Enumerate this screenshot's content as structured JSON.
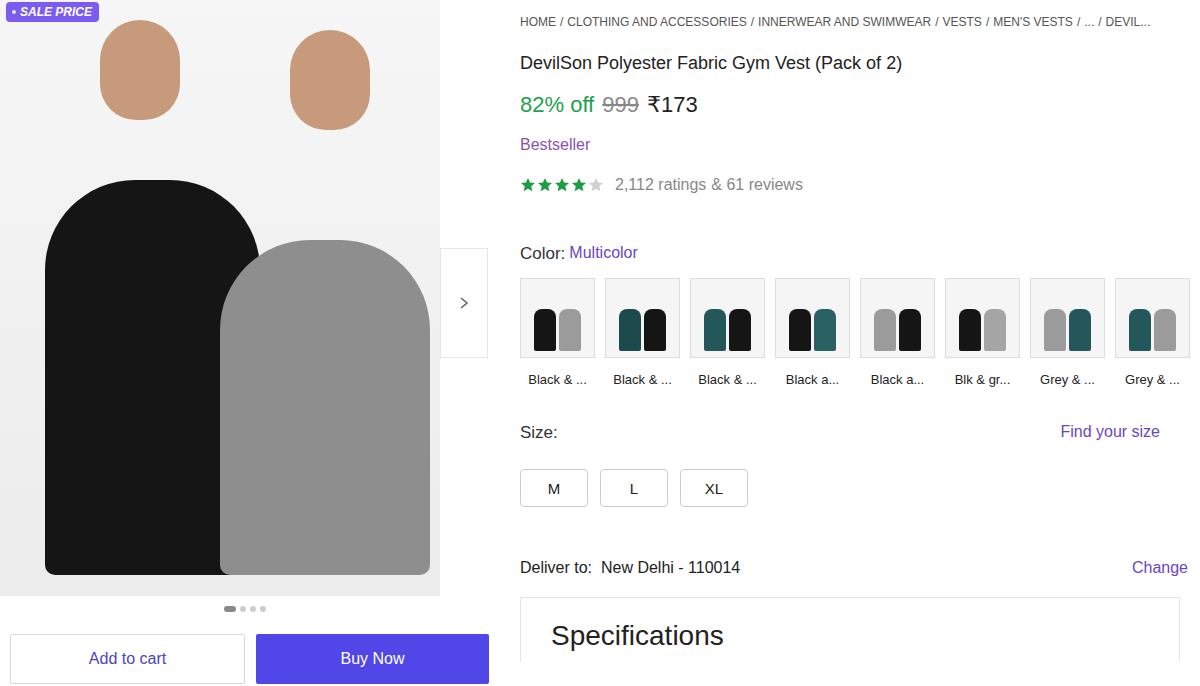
{
  "badge": "SALE PRICE",
  "breadcrumb": {
    "separator": "/",
    "items": [
      "HOME",
      "CLOTHING AND ACCESSORIES",
      "INNERWEAR AND SWIMWEAR",
      "VESTS",
      "MEN'S VESTS",
      "...",
      "DEVIL..."
    ]
  },
  "product": {
    "title": "DevilSon Polyester Fabric Gym Vest (Pack of 2)",
    "discount": "82% off",
    "mrp": "999",
    "price": "₹173",
    "tag": "Bestseller"
  },
  "rating": {
    "stars": 4,
    "ratings": "2,112 ratings",
    "reviews": "& 61 reviews"
  },
  "color": {
    "label": "Color:",
    "value": "Multicolor",
    "options": [
      {
        "label": "Black & ...",
        "colors": [
          "#151515",
          "#9b9b9b"
        ]
      },
      {
        "label": "Black & ...",
        "colors": [
          "#1d4a4c",
          "#151515"
        ]
      },
      {
        "label": "Black & ...",
        "colors": [
          "#23575a",
          "#151515"
        ]
      },
      {
        "label": "Black a...",
        "colors": [
          "#151515",
          "#2a6264"
        ]
      },
      {
        "label": "Black a...",
        "colors": [
          "#9b9b9b",
          "#151515"
        ]
      },
      {
        "label": "Blk & gr...",
        "colors": [
          "#151515",
          "#a5a5a5"
        ]
      },
      {
        "label": "Grey & ...",
        "colors": [
          "#9b9b9b",
          "#23575a"
        ]
      },
      {
        "label": "Grey & ...",
        "colors": [
          "#23575a",
          "#9b9b9b"
        ]
      }
    ]
  },
  "size": {
    "label": "Size:",
    "link": "Find your size",
    "options": [
      "M",
      "L",
      "XL"
    ]
  },
  "delivery": {
    "label": "Deliver to:",
    "location": "New Delhi - 110014",
    "action": "Change"
  },
  "specifications": "Specifications",
  "carousel": {
    "dots": [
      {
        "selected": true
      },
      {
        "selected": false
      },
      {
        "selected": false
      },
      {
        "selected": false
      }
    ]
  },
  "buttons": {
    "add_to_cart": "Add to cart",
    "buy_now": "Buy Now"
  }
}
